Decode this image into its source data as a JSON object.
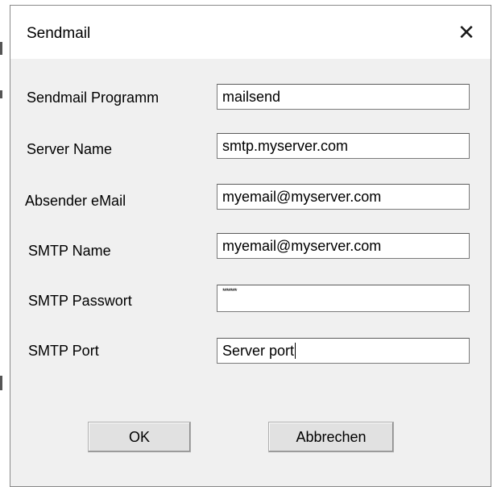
{
  "dialog": {
    "title": "Sendmail",
    "close_glyph": "✕",
    "close_icon": "close-icon"
  },
  "fields": [
    {
      "label": "Sendmail Programm",
      "value": "mailsend"
    },
    {
      "label": "Server Name",
      "value": "smtp.myserver.com"
    },
    {
      "label": "Absender eMail",
      "value": "myemail@myserver.com"
    },
    {
      "label": "SMTP Name",
      "value": "myemail@myserver.com"
    },
    {
      "label": "SMTP Passwort",
      "value": "*******"
    },
    {
      "label": "SMTP Port",
      "value": "Server port"
    }
  ],
  "buttons": {
    "ok": "OK",
    "cancel": "Abbrechen"
  }
}
